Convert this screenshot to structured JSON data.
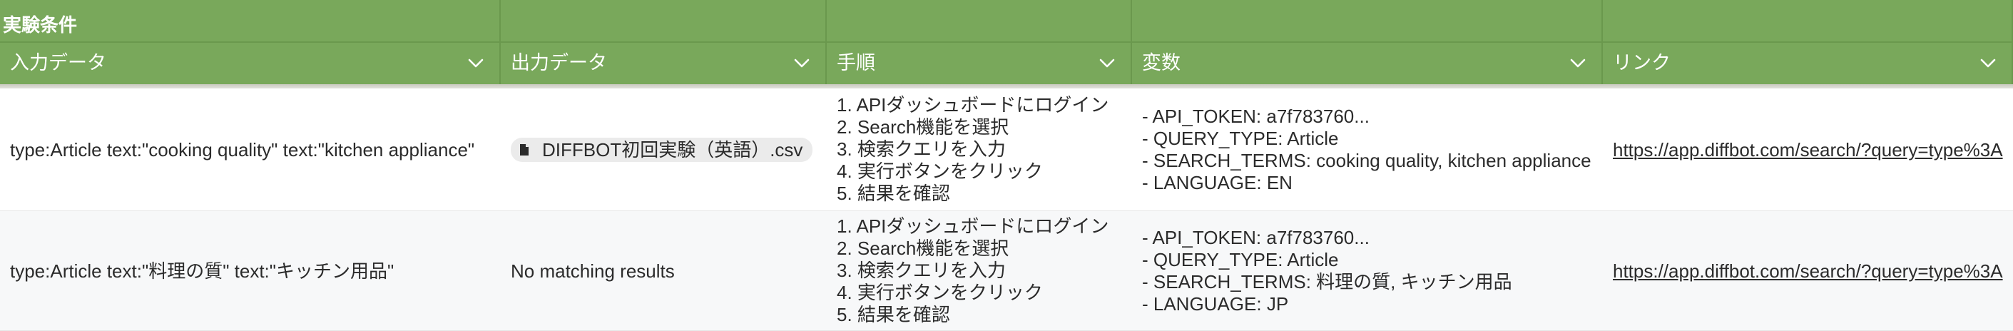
{
  "group_header": {
    "title": "実験条件"
  },
  "columns": [
    {
      "label": "入力データ"
    },
    {
      "label": "出力データ"
    },
    {
      "label": "手順"
    },
    {
      "label": "変数"
    },
    {
      "label": "リンク"
    }
  ],
  "rows": [
    {
      "input": "type:Article text:\"cooking quality\" text:\"kitchen appliance\"",
      "output_file": "DIFFBOT初回実験（英語）.csv",
      "steps": [
        "1. APIダッシュボードにログイン",
        "2. Search機能を選択",
        "3. 検索クエリを入力",
        "4. 実行ボタンをクリック",
        "5. 結果を確認"
      ],
      "variables": [
        "- API_TOKEN: a7f783760...",
        "- QUERY_TYPE: Article",
        "- SEARCH_TERMS: cooking quality, kitchen appliance",
        "- LANGUAGE: EN"
      ],
      "link": "https://app.diffbot.com/search/?query=type%3A"
    },
    {
      "input": "type:Article text:\"料理の質\" text:\"キッチン用品\"",
      "output_text": "No matching results",
      "steps": [
        "1. APIダッシュボードにログイン",
        "2. Search機能を選択",
        "3. 検索クエリを入力",
        "4. 実行ボタンをクリック",
        "5. 結果を確認"
      ],
      "variables": [
        "- API_TOKEN: a7f783760...",
        "- QUERY_TYPE: Article",
        "- SEARCH_TERMS: 料理の質, キッチン用品",
        "- LANGUAGE: JP"
      ],
      "link": "https://app.diffbot.com/search/?query=type%3A"
    }
  ],
  "colors": {
    "header_bg": "#79a85b",
    "header_border": "#6a984d",
    "header_text": "#ffffff",
    "row_alt_bg": "#f7f8f9",
    "chip_bg": "#ebebeb"
  },
  "icons": {
    "column_menu": "chevron-down-icon",
    "file": "file-icon"
  }
}
